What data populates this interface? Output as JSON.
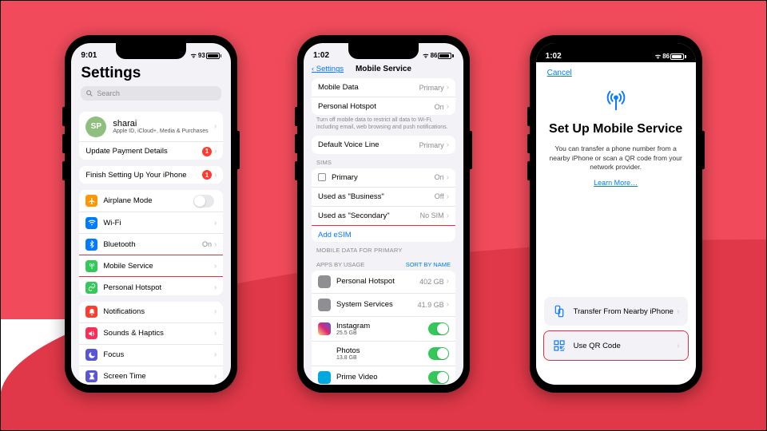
{
  "phone1": {
    "status": {
      "time": "9:01",
      "signal": "􀙇",
      "batteryPct": 93,
      "batteryWidth": "88%"
    },
    "title": "Settings",
    "searchPlaceholder": "Search",
    "account": {
      "initials": "SP",
      "name": "sharai",
      "sub": "Apple ID, iCloud+, Media & Purchases"
    },
    "alerts": [
      {
        "label": "Update Payment Details",
        "badge": "1"
      },
      {
        "label": "Finish Setting Up Your iPhone",
        "badge": "1"
      }
    ],
    "group1": [
      {
        "icon": "airplane",
        "color": "#ff9500",
        "label": "Airplane Mode",
        "trailing": "toggle"
      },
      {
        "icon": "wifi",
        "color": "#007aff",
        "label": "Wi-Fi",
        "trailing": "chev"
      },
      {
        "icon": "bluetooth",
        "color": "#007aff",
        "label": "Bluetooth",
        "value": "On",
        "trailing": "chev"
      },
      {
        "icon": "antenna",
        "color": "#34c759",
        "label": "Mobile Service",
        "trailing": "chev",
        "highlight": true
      },
      {
        "icon": "link",
        "color": "#34c759",
        "label": "Personal Hotspot",
        "trailing": "chev"
      }
    ],
    "group2": [
      {
        "icon": "bell",
        "color": "#ff3b30",
        "label": "Notifications"
      },
      {
        "icon": "speaker",
        "color": "#ff2d55",
        "label": "Sounds & Haptics"
      },
      {
        "icon": "moon",
        "color": "#5856d6",
        "label": "Focus"
      },
      {
        "icon": "hourglass",
        "color": "#5856d6",
        "label": "Screen Time"
      }
    ]
  },
  "phone2": {
    "status": {
      "time": "1:02",
      "batteryPct": 86,
      "batteryWidth": "80%"
    },
    "back": "Settings",
    "title": "Mobile Service",
    "top": [
      {
        "label": "Mobile Data",
        "value": "Primary"
      },
      {
        "label": "Personal Hotspot",
        "value": "On"
      }
    ],
    "footnote": "Turn off mobile data to restrict all data to Wi-Fi, including email, web browsing and push notifications.",
    "voice": {
      "label": "Default Voice Line",
      "value": "Primary"
    },
    "simsHeader": "SIMs",
    "sims": [
      {
        "label": "Primary",
        "value": "On",
        "box": true
      },
      {
        "label": "Used as \"Business\"",
        "value": "Off"
      },
      {
        "label": "Used as \"Secondary\"",
        "value": "No SIM"
      }
    ],
    "addEsim": "Add eSIM",
    "mdpHeader": "MOBILE DATA FOR PRIMARY",
    "appsHeader": "APPS BY USAGE",
    "sortBy": "SORT BY NAME",
    "apps": [
      {
        "label": "Personal Hotspot",
        "value": "402 GB",
        "color": "#8e8e93",
        "chev": true
      },
      {
        "label": "System Services",
        "value": "41.9 GB",
        "color": "#8e8e93",
        "chev": true
      },
      {
        "label": "Instagram",
        "sub": "25.5 GB",
        "color": "linear-gradient(45deg,#feda75,#d62976,#4f5bd5)",
        "toggle": true
      },
      {
        "label": "Photos",
        "sub": "13.8 GB",
        "color": "#fff",
        "toggle": true
      },
      {
        "label": "Prime Video",
        "sub": "",
        "color": "#00a8e1",
        "toggle": true
      }
    ]
  },
  "phone3": {
    "status": {
      "time": "1:02",
      "batteryPct": 86,
      "batteryWidth": "80%"
    },
    "cancel": "Cancel",
    "title": "Set Up Mobile Service",
    "desc": "You can transfer a phone number from a nearby iPhone or scan a QR code from your network provider.",
    "learnMore": "Learn More…",
    "options": [
      {
        "icon": "transfer",
        "label": "Transfer From Nearby iPhone"
      },
      {
        "icon": "qr",
        "label": "Use QR Code",
        "highlight": true
      }
    ]
  }
}
